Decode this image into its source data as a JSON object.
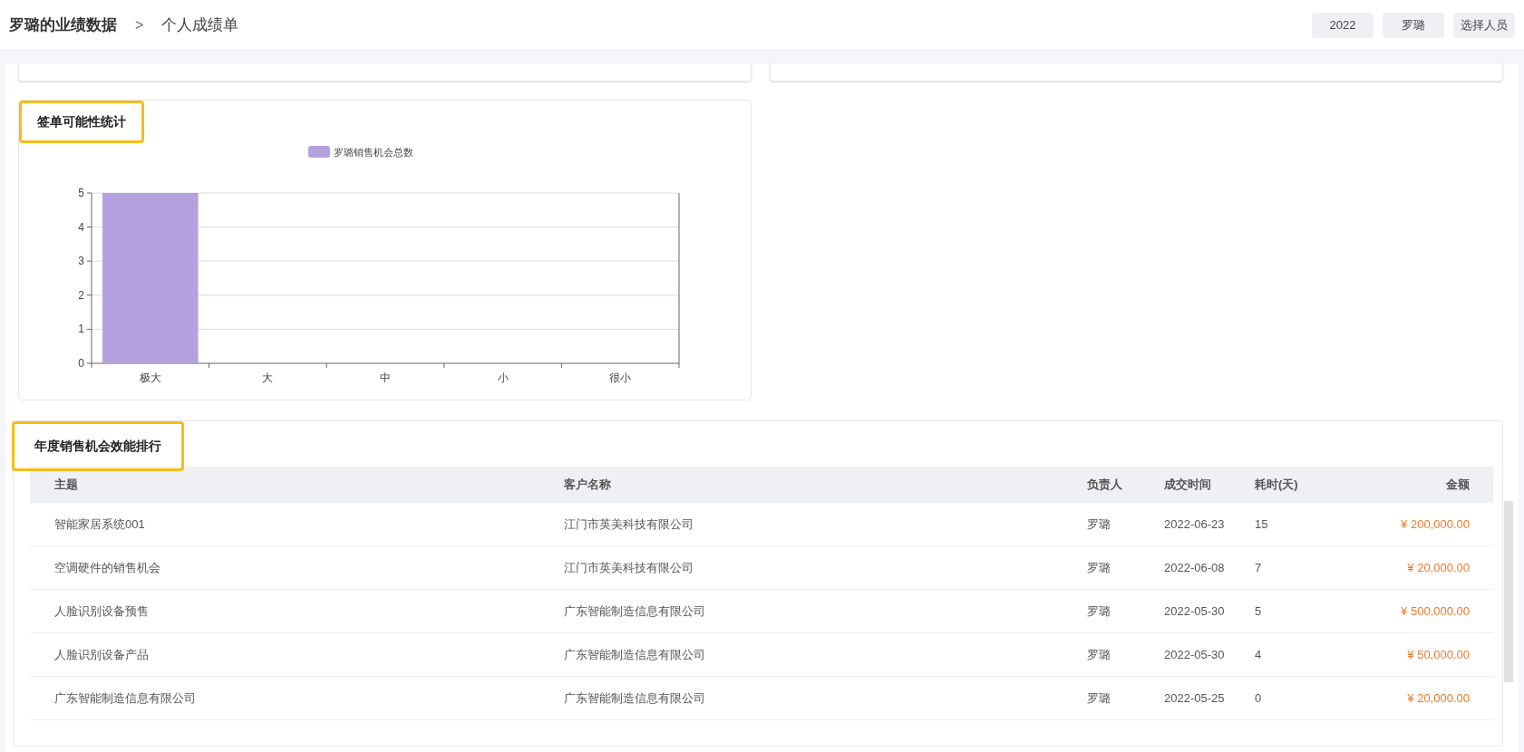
{
  "breadcrumb": {
    "title": "罗璐的业绩数据",
    "separator": ">",
    "current": "个人成绩单"
  },
  "toolbar": {
    "year": "2022",
    "person": "罗璐",
    "select_button": "选择人员"
  },
  "chart_card": {
    "title": "签单可能性统计",
    "chart_data": {
      "type": "bar",
      "categories": [
        "极大",
        "大",
        "中",
        "小",
        "很小"
      ],
      "series": [
        {
          "name": "罗璐销售机会总数",
          "color": "#b5a1de",
          "values": [
            5,
            0,
            0,
            0,
            0
          ]
        }
      ],
      "ylim": [
        0,
        5
      ],
      "grid": true,
      "yticks": [
        0,
        1,
        2,
        3,
        4,
        5
      ]
    }
  },
  "table_card": {
    "title": "年度销售机会效能排行",
    "columns": [
      "主题",
      "客户名称",
      "负责人",
      "成交时间",
      "耗时(天)",
      "金额"
    ],
    "rows": [
      [
        "智能家居系统001",
        "江门市英美科技有限公司",
        "罗璐",
        "2022-06-23",
        "15",
        "¥ 200,000.00"
      ],
      [
        "空调硬件的销售机会",
        "江门市英美科技有限公司",
        "罗璐",
        "2022-06-08",
        "7",
        "¥ 20,000.00"
      ],
      [
        "人脸识别设备预售",
        "广东智能制造信息有限公司",
        "罗璐",
        "2022-05-30",
        "5",
        "¥ 500,000.00"
      ],
      [
        "人脸识别设备产品",
        "广东智能制造信息有限公司",
        "罗璐",
        "2022-05-30",
        "4",
        "¥ 50,000.00"
      ],
      [
        "广东智能制造信息有限公司",
        "广东智能制造信息有限公司",
        "罗璐",
        "2022-05-25",
        "0",
        "¥ 20,000.00"
      ]
    ]
  }
}
